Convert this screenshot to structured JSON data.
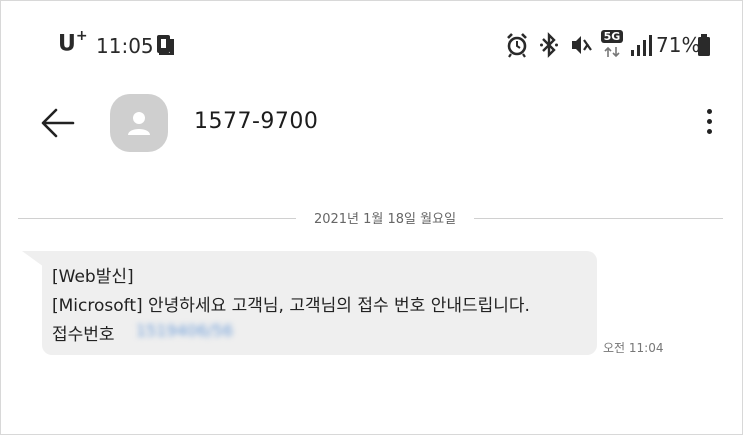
{
  "status_bar": {
    "carrier": "U",
    "carrier_sup": "+",
    "time": "11:05",
    "network": "5G",
    "battery": "71%"
  },
  "header": {
    "contact": "1577-9700"
  },
  "conversation": {
    "date_separator": "2021년 1월 18일 월요일",
    "message": {
      "line1": "[Web발신]",
      "line2": "[Microsoft] 안녕하세요 고객님, 고객님의 접수 번호 안내드립니다.",
      "line3_label": "접수번호",
      "line3_value": "1519406/56",
      "time": "오전 11:04"
    }
  },
  "colors": {
    "bubble": "#efefef",
    "link": "#6c9cd8"
  }
}
